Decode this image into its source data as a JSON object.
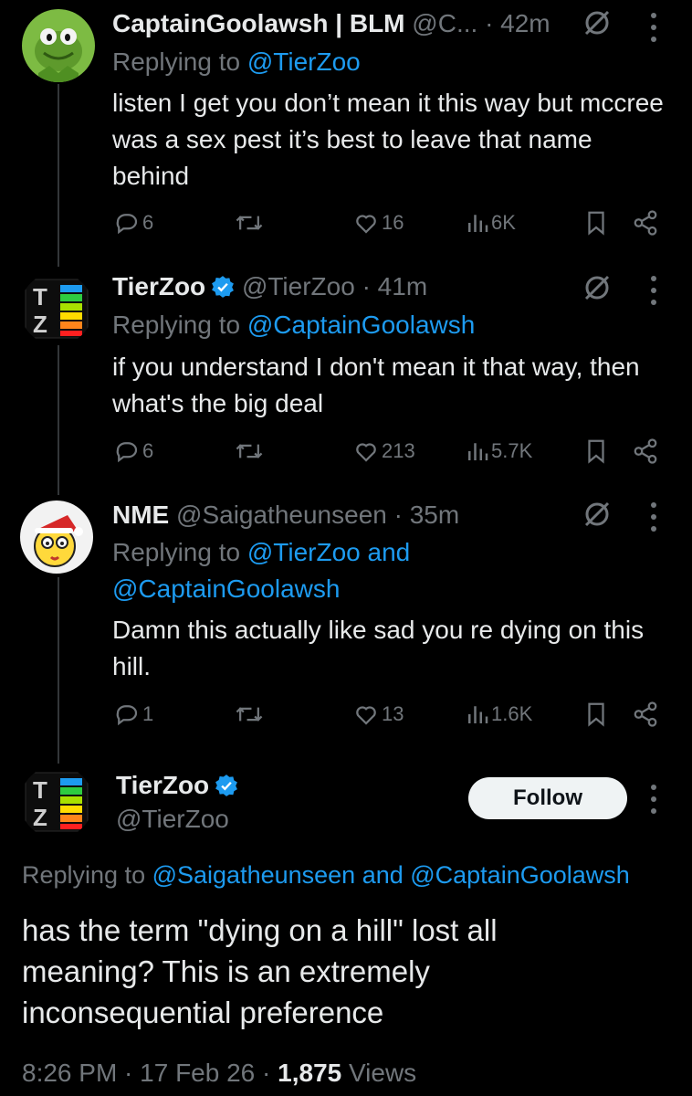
{
  "replies": [
    {
      "author_name": "CaptainGoolawsh | BLM",
      "handle": "@C...",
      "time": "· 42m",
      "replying_prefix": "Replying to",
      "replying_to": "@TierZoo",
      "text": "listen I get you don’t mean it this way but mccree was a sex pest it’s best to leave that name behind",
      "reply_count": "6",
      "like_count": "16",
      "view_count": "6K",
      "verified": false
    },
    {
      "author_name": "TierZoo",
      "handle": "@TierZoo",
      "time": "· 41m",
      "replying_prefix": "Replying to",
      "replying_to": "@CaptainGoolawsh",
      "text": "if you understand I don't mean it that way, then what's the big deal",
      "reply_count": "6",
      "like_count": "213",
      "view_count": "5.7K",
      "verified": true
    },
    {
      "author_name": "NME",
      "handle": "@Saigatheunseen",
      "time": "· 35m",
      "replying_prefix": "Replying to",
      "replying_to": "@TierZoo and @CaptainGoolawsh",
      "text": "Damn this actually like sad you re dying on this hill.",
      "reply_count": "1",
      "like_count": "13",
      "view_count": "1.6K",
      "verified": false
    }
  ],
  "main_post": {
    "author_name": "TierZoo",
    "handle": "@TierZoo",
    "follow_label": "Follow",
    "replying_prefix": "Replying to",
    "replying_to": "@Saigatheunseen and @CaptainGoolawsh",
    "text": "has the term \"dying on a hill\" lost all meaning? This is an extremely inconsequential preference",
    "time": "8:26 PM · 17 Feb 26 ·",
    "views_count": "1,875",
    "views_label": "Views"
  },
  "colors": {
    "background": "#000000",
    "text": "#e7e9ea",
    "muted": "#71767b",
    "link": "#1d9bf0",
    "verified": "#1d9bf0"
  },
  "icons": {
    "reply": "reply-icon",
    "retweet": "retweet-icon",
    "like": "like-icon",
    "views": "views-icon",
    "bookmark": "bookmark-icon",
    "share": "share-icon",
    "grok": "grok-icon",
    "more": "more-icon",
    "verified": "verified-badge-icon"
  }
}
